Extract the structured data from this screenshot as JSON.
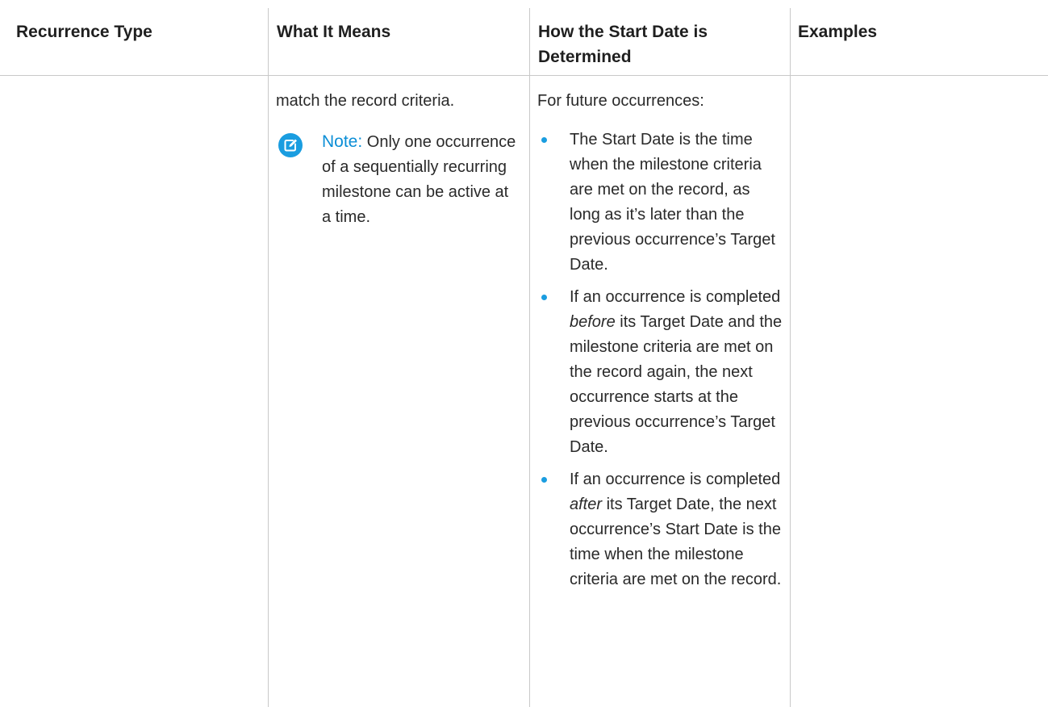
{
  "table": {
    "headers": {
      "recurrence_type": "Recurrence Type",
      "what_it_means": "What It Means",
      "start_date": "How the Start Date is Determined",
      "examples": "Examples"
    },
    "row": {
      "recurrence_type": "",
      "what_it_means_text": "match the record criteria.",
      "note": {
        "label": "Note:",
        "text": "Only one occurrence of a sequentially recurring milestone can be active at a time.",
        "icon": "edit-note-icon",
        "color": "#1a9de0"
      },
      "start_date_intro": "For future occurrences:",
      "bullets": [
        {
          "before": "The Start Date is the time when the milestone criteria are met on the record, as long as it’s later than the previous occurrence’s Target Date.",
          "em": "",
          "after": ""
        },
        {
          "before": "If an occurrence is completed ",
          "em": "before",
          "after": " its Target Date and the milestone criteria are met on the record again, the next occurrence starts at the previous occurrence’s Target Date."
        },
        {
          "before": "If an occurrence is completed ",
          "em": "after",
          "after": " its Target Date, the next occurrence’s Start Date is the time when the milestone criteria are met on the record."
        }
      ],
      "examples": ""
    }
  },
  "colors": {
    "accent": "#1a9de0",
    "note_label": "#0b8ed6",
    "rule": "#c9c9c9"
  }
}
